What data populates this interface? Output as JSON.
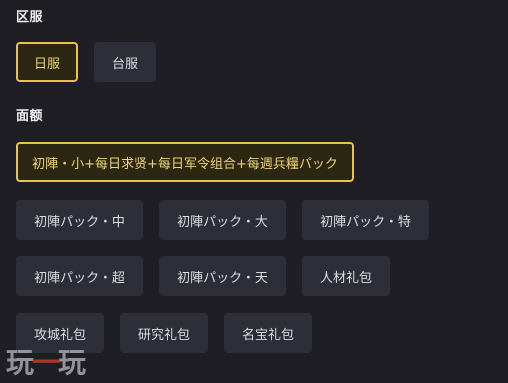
{
  "server_section": {
    "title": "区服",
    "options": [
      {
        "label": "日服",
        "selected": true
      },
      {
        "label": "台服",
        "selected": false
      }
    ]
  },
  "amount_section": {
    "title": "面额",
    "options": [
      {
        "label": "初陣・小+每日求贤+每日军令组合+每週兵糧パック",
        "selected": true
      },
      {
        "label": "初陣パック・中",
        "selected": false
      },
      {
        "label": "初陣パック・大",
        "selected": false
      },
      {
        "label": "初陣パック・特",
        "selected": false
      },
      {
        "label": "初陣パック・超",
        "selected": false
      },
      {
        "label": "初陣パック・天",
        "selected": false
      },
      {
        "label": "人材礼包",
        "selected": false
      },
      {
        "label": "攻城礼包",
        "selected": false
      },
      {
        "label": "研究礼包",
        "selected": false
      },
      {
        "label": "名宝礼包",
        "selected": false
      }
    ]
  },
  "watermark": {
    "text_1": "玩",
    "text_2": "一",
    "text_3": "玩"
  },
  "colors": {
    "background": "#1e1e24",
    "chip_background": "#2e2e38",
    "selected_border": "#e8c44c",
    "selected_text": "#f0d373"
  }
}
